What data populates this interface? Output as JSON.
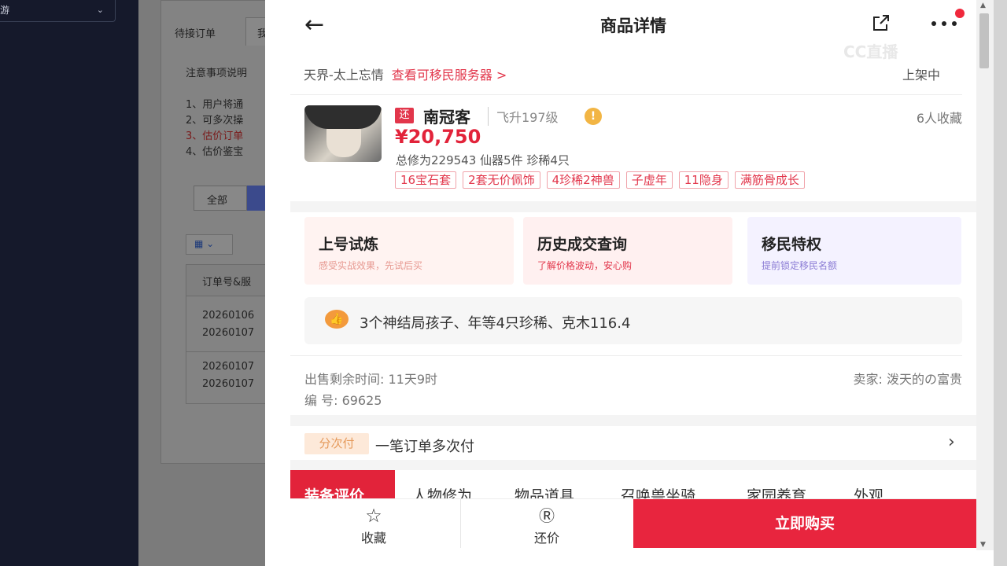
{
  "sidebar": {
    "dropdown_label": "游"
  },
  "admin": {
    "tab_pending": "待接订单",
    "tab_partial": "我",
    "notice_title": "注意事项说明",
    "rules": [
      "1、用户将通",
      "2、可多次操",
      "3、估价订单",
      "4、估价鉴宝"
    ],
    "filter_all": "全部",
    "table_header": "订单号&服",
    "rows": [
      [
        "20260106",
        "20260107"
      ],
      [
        "20260107",
        "20260107"
      ]
    ]
  },
  "header": {
    "title": "商品详情",
    "back_icon": "arrow-left-icon",
    "share_icon": "share-icon",
    "more_icon": "more-icon"
  },
  "server": {
    "name": "天界-太上忘情",
    "link": "查看可移民服务器 >",
    "status": "上架中"
  },
  "product": {
    "badge": "还",
    "name": "南冠客",
    "level": "飞升197级",
    "favorites": "6人收藏",
    "price": "¥20,750",
    "stats": "总修为229543  仙器5件  珍稀4只",
    "tags": [
      "16宝石套",
      "2套无价佩饰",
      "4珍稀2神兽",
      "子虚年",
      "11隐身",
      "满筋骨成长"
    ]
  },
  "features": [
    {
      "title": "上号试炼",
      "sub": "感受实战效果，先试后买"
    },
    {
      "title": "历史成交查询",
      "sub": "了解价格波动，安心购"
    },
    {
      "title": "移民特权",
      "sub": "提前锁定移民名额"
    }
  ],
  "highlight": "3个神结局孩子、年等4只珍稀、克木116.4",
  "meta": {
    "time_left": "出售剩余时间: 11天9时",
    "serial": "编 号: 69625",
    "seller": "卖家: 泼天的の富贵"
  },
  "payment": {
    "badge": "分次付",
    "text": "一笔订单多次付"
  },
  "tabs": [
    "装备评价",
    "人物修为",
    "物品道具",
    "召唤兽坐骑",
    "家园养育",
    "外观"
  ],
  "bottom": {
    "favorite": "收藏",
    "bargain": "还价",
    "buy": "立即购买"
  },
  "watermark": "CC直播",
  "colors": {
    "accent": "#e2233a",
    "sidebar": "#15192b"
  }
}
